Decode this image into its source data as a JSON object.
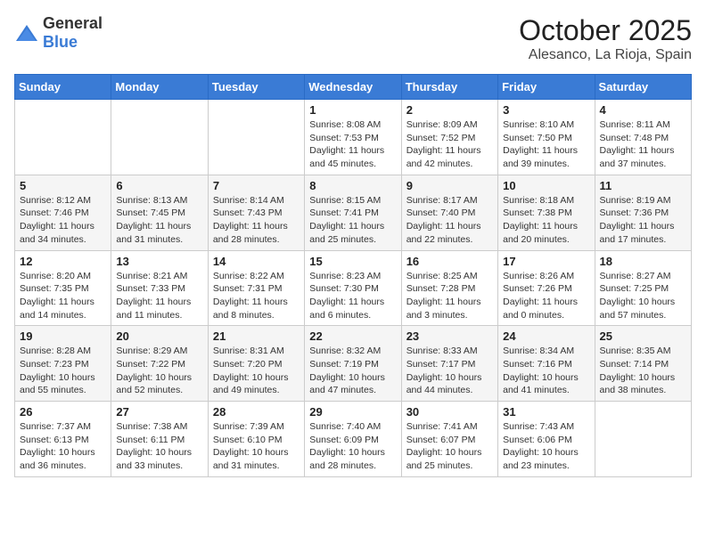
{
  "header": {
    "logo_general": "General",
    "logo_blue": "Blue",
    "month_title": "October 2025",
    "location": "Alesanco, La Rioja, Spain"
  },
  "weekdays": [
    "Sunday",
    "Monday",
    "Tuesday",
    "Wednesday",
    "Thursday",
    "Friday",
    "Saturday"
  ],
  "weeks": [
    [
      {
        "day": "",
        "info": ""
      },
      {
        "day": "",
        "info": ""
      },
      {
        "day": "",
        "info": ""
      },
      {
        "day": "1",
        "info": "Sunrise: 8:08 AM\nSunset: 7:53 PM\nDaylight: 11 hours and 45 minutes."
      },
      {
        "day": "2",
        "info": "Sunrise: 8:09 AM\nSunset: 7:52 PM\nDaylight: 11 hours and 42 minutes."
      },
      {
        "day": "3",
        "info": "Sunrise: 8:10 AM\nSunset: 7:50 PM\nDaylight: 11 hours and 39 minutes."
      },
      {
        "day": "4",
        "info": "Sunrise: 8:11 AM\nSunset: 7:48 PM\nDaylight: 11 hours and 37 minutes."
      }
    ],
    [
      {
        "day": "5",
        "info": "Sunrise: 8:12 AM\nSunset: 7:46 PM\nDaylight: 11 hours and 34 minutes."
      },
      {
        "day": "6",
        "info": "Sunrise: 8:13 AM\nSunset: 7:45 PM\nDaylight: 11 hours and 31 minutes."
      },
      {
        "day": "7",
        "info": "Sunrise: 8:14 AM\nSunset: 7:43 PM\nDaylight: 11 hours and 28 minutes."
      },
      {
        "day": "8",
        "info": "Sunrise: 8:15 AM\nSunset: 7:41 PM\nDaylight: 11 hours and 25 minutes."
      },
      {
        "day": "9",
        "info": "Sunrise: 8:17 AM\nSunset: 7:40 PM\nDaylight: 11 hours and 22 minutes."
      },
      {
        "day": "10",
        "info": "Sunrise: 8:18 AM\nSunset: 7:38 PM\nDaylight: 11 hours and 20 minutes."
      },
      {
        "day": "11",
        "info": "Sunrise: 8:19 AM\nSunset: 7:36 PM\nDaylight: 11 hours and 17 minutes."
      }
    ],
    [
      {
        "day": "12",
        "info": "Sunrise: 8:20 AM\nSunset: 7:35 PM\nDaylight: 11 hours and 14 minutes."
      },
      {
        "day": "13",
        "info": "Sunrise: 8:21 AM\nSunset: 7:33 PM\nDaylight: 11 hours and 11 minutes."
      },
      {
        "day": "14",
        "info": "Sunrise: 8:22 AM\nSunset: 7:31 PM\nDaylight: 11 hours and 8 minutes."
      },
      {
        "day": "15",
        "info": "Sunrise: 8:23 AM\nSunset: 7:30 PM\nDaylight: 11 hours and 6 minutes."
      },
      {
        "day": "16",
        "info": "Sunrise: 8:25 AM\nSunset: 7:28 PM\nDaylight: 11 hours and 3 minutes."
      },
      {
        "day": "17",
        "info": "Sunrise: 8:26 AM\nSunset: 7:26 PM\nDaylight: 11 hours and 0 minutes."
      },
      {
        "day": "18",
        "info": "Sunrise: 8:27 AM\nSunset: 7:25 PM\nDaylight: 10 hours and 57 minutes."
      }
    ],
    [
      {
        "day": "19",
        "info": "Sunrise: 8:28 AM\nSunset: 7:23 PM\nDaylight: 10 hours and 55 minutes."
      },
      {
        "day": "20",
        "info": "Sunrise: 8:29 AM\nSunset: 7:22 PM\nDaylight: 10 hours and 52 minutes."
      },
      {
        "day": "21",
        "info": "Sunrise: 8:31 AM\nSunset: 7:20 PM\nDaylight: 10 hours and 49 minutes."
      },
      {
        "day": "22",
        "info": "Sunrise: 8:32 AM\nSunset: 7:19 PM\nDaylight: 10 hours and 47 minutes."
      },
      {
        "day": "23",
        "info": "Sunrise: 8:33 AM\nSunset: 7:17 PM\nDaylight: 10 hours and 44 minutes."
      },
      {
        "day": "24",
        "info": "Sunrise: 8:34 AM\nSunset: 7:16 PM\nDaylight: 10 hours and 41 minutes."
      },
      {
        "day": "25",
        "info": "Sunrise: 8:35 AM\nSunset: 7:14 PM\nDaylight: 10 hours and 38 minutes."
      }
    ],
    [
      {
        "day": "26",
        "info": "Sunrise: 7:37 AM\nSunset: 6:13 PM\nDaylight: 10 hours and 36 minutes."
      },
      {
        "day": "27",
        "info": "Sunrise: 7:38 AM\nSunset: 6:11 PM\nDaylight: 10 hours and 33 minutes."
      },
      {
        "day": "28",
        "info": "Sunrise: 7:39 AM\nSunset: 6:10 PM\nDaylight: 10 hours and 31 minutes."
      },
      {
        "day": "29",
        "info": "Sunrise: 7:40 AM\nSunset: 6:09 PM\nDaylight: 10 hours and 28 minutes."
      },
      {
        "day": "30",
        "info": "Sunrise: 7:41 AM\nSunset: 6:07 PM\nDaylight: 10 hours and 25 minutes."
      },
      {
        "day": "31",
        "info": "Sunrise: 7:43 AM\nSunset: 6:06 PM\nDaylight: 10 hours and 23 minutes."
      },
      {
        "day": "",
        "info": ""
      }
    ]
  ]
}
